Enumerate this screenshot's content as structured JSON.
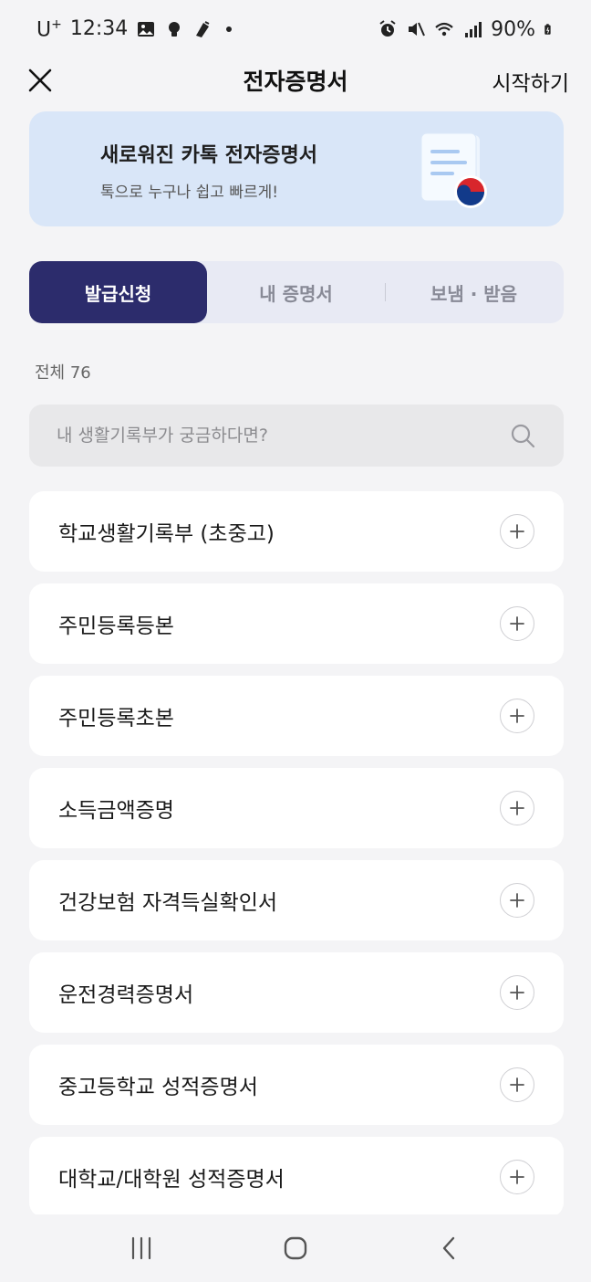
{
  "status": {
    "carrier": "U",
    "carrier_sup": "+",
    "time": "12:34",
    "battery": "90%"
  },
  "header": {
    "title": "전자증명서",
    "start_label": "시작하기"
  },
  "banner": {
    "title": "새로워진 카톡 전자증명서",
    "subtitle": "톡으로 누구나 쉽고 빠르게!"
  },
  "tabs": [
    {
      "label": "발급신청",
      "active": true
    },
    {
      "label": "내 증명서",
      "active": false
    },
    {
      "label": "보냄 · 받음",
      "active": false
    }
  ],
  "count_label": "전체 76",
  "search": {
    "placeholder": "내 생활기록부가 궁금하다면?"
  },
  "documents": [
    {
      "label": "학교생활기록부 (초중고)"
    },
    {
      "label": "주민등록등본"
    },
    {
      "label": "주민등록초본"
    },
    {
      "label": "소득금액증명"
    },
    {
      "label": "건강보험 자격득실확인서"
    },
    {
      "label": "운전경력증명서"
    },
    {
      "label": "중고등학교 성적증명서"
    },
    {
      "label": "대학교/대학원 성적증명서"
    }
  ],
  "colors": {
    "accent": "#2c2c6c",
    "banner_bg": "#d9e6f8",
    "tab_bg": "#e8eaf4"
  }
}
